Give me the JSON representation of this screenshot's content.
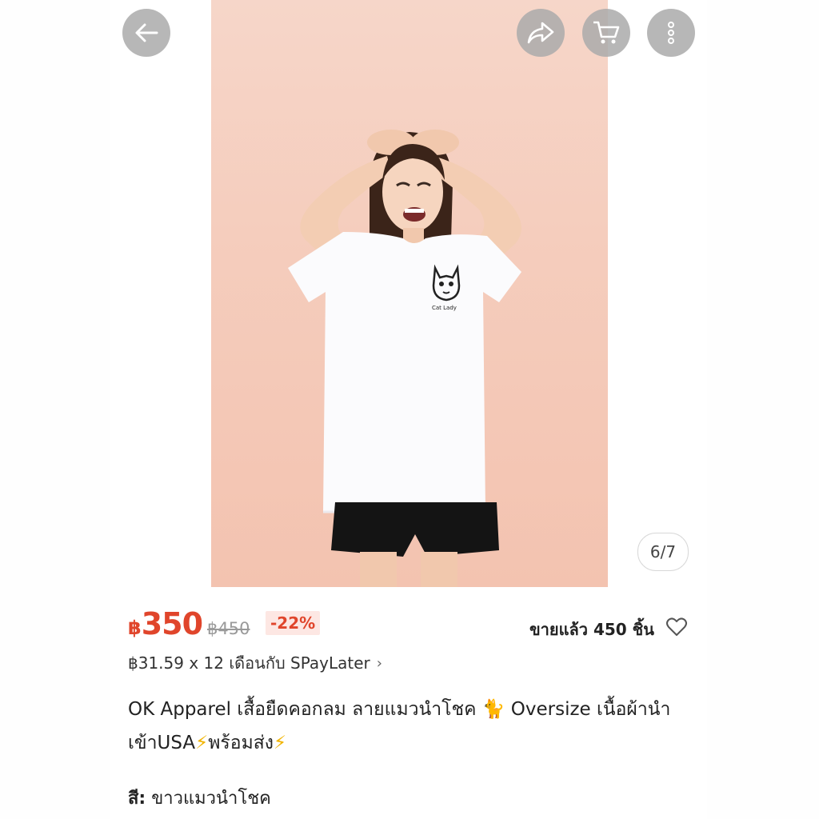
{
  "header": {
    "back_icon": "arrow-left-icon",
    "share_icon": "share-icon",
    "cart_icon": "cart-icon",
    "more_icon": "more-vertical-icon"
  },
  "gallery": {
    "counter": "6/7",
    "badge_text": "Cat Lady"
  },
  "price": {
    "currency": "฿",
    "current": "350",
    "original": "฿450",
    "discount": "-22%"
  },
  "sold": "ขายแล้ว 450 ชิ้น",
  "installment": "฿31.59 x 12 เดือนกับ SPayLater",
  "product": {
    "title_part1": "OK Apparel เสื้อยืดคอกลม ลายแมวนำโชค 🐈 Oversize เนื้อผ้านำเข้าUSA",
    "title_part2": "พร้อมส่ง",
    "color_label": "สี:",
    "color_value": "ขาวแมวนำโชค"
  },
  "colors": {
    "accent": "#e0452b",
    "discount_bg": "#fde7e3",
    "bolt": "#f1b400"
  }
}
